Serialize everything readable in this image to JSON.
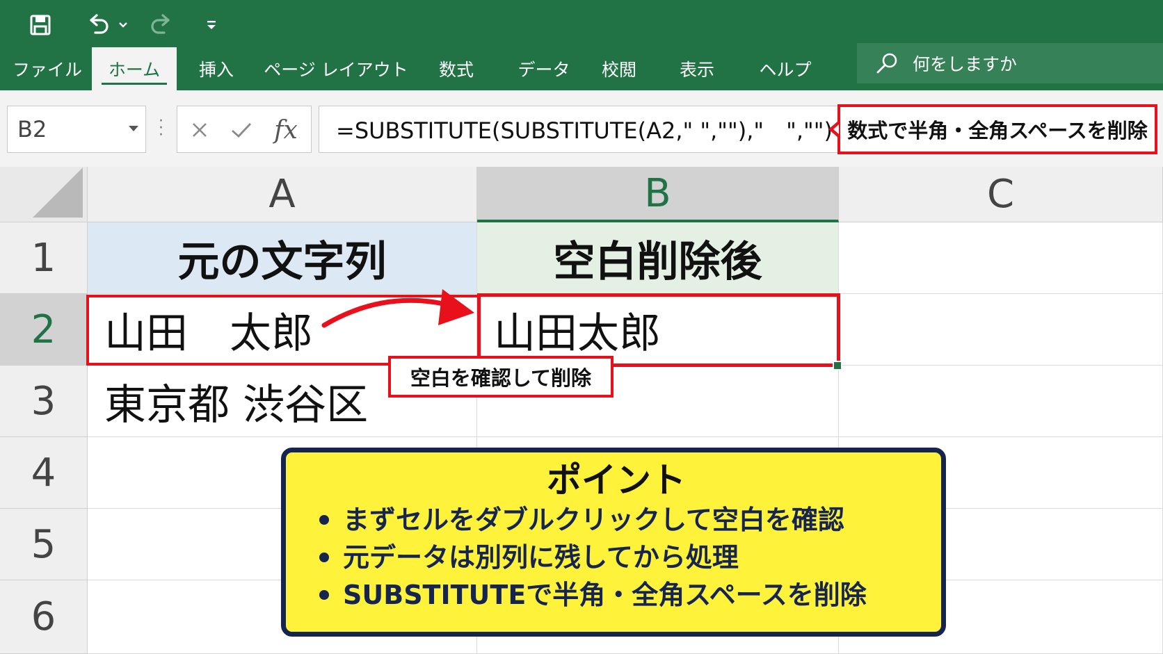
{
  "colors": {
    "ribbon": "#217346",
    "callout_border": "#e8101a",
    "point_bg": "#fff23a",
    "point_border": "#16254f",
    "header_a_fill": "#dde8f5",
    "header_b_fill": "#e4f0e4"
  },
  "quick_access": {
    "save_icon": "save-icon",
    "undo_icon": "undo-icon",
    "redo_icon": "redo-icon",
    "customize_icon": "chevron-down-icon"
  },
  "ribbon": {
    "tabs": [
      {
        "label": "ファイル",
        "active": false
      },
      {
        "label": "ホーム",
        "active": true
      },
      {
        "label": "挿入",
        "active": false
      },
      {
        "label": "ページ レイアウト",
        "active": false
      },
      {
        "label": "数式",
        "active": false
      },
      {
        "label": "データ",
        "active": false
      },
      {
        "label": "校閲",
        "active": false
      },
      {
        "label": "表示",
        "active": false
      },
      {
        "label": "ヘルプ",
        "active": false
      }
    ],
    "tell_me": "何をしますか"
  },
  "formula_bar": {
    "name_box": "B2",
    "formula": "=SUBSTITUTE(SUBSTITUTE(A2,\" \",\"\"),\"　\",\"\")",
    "callout": "数式で半角・全角スペースを削除"
  },
  "grid": {
    "columns": [
      "A",
      "B",
      "C"
    ],
    "selected_column": "B",
    "rows": [
      "1",
      "2",
      "3",
      "4",
      "5",
      "6"
    ],
    "selected_row": "2",
    "cells": {
      "A1": "元の文字列",
      "B1": "空白削除後",
      "A2": "山田　太郎",
      "B2": "山田太郎",
      "A3": "東京都 渋谷区"
    },
    "callout": "空白を確認して削除"
  },
  "point": {
    "title": "ポイント",
    "items": [
      "まずセルをダブルクリックして空白を確認",
      "元データは別列に残してから処理",
      "SUBSTITUTEで半角・全角スペースを削除"
    ]
  }
}
